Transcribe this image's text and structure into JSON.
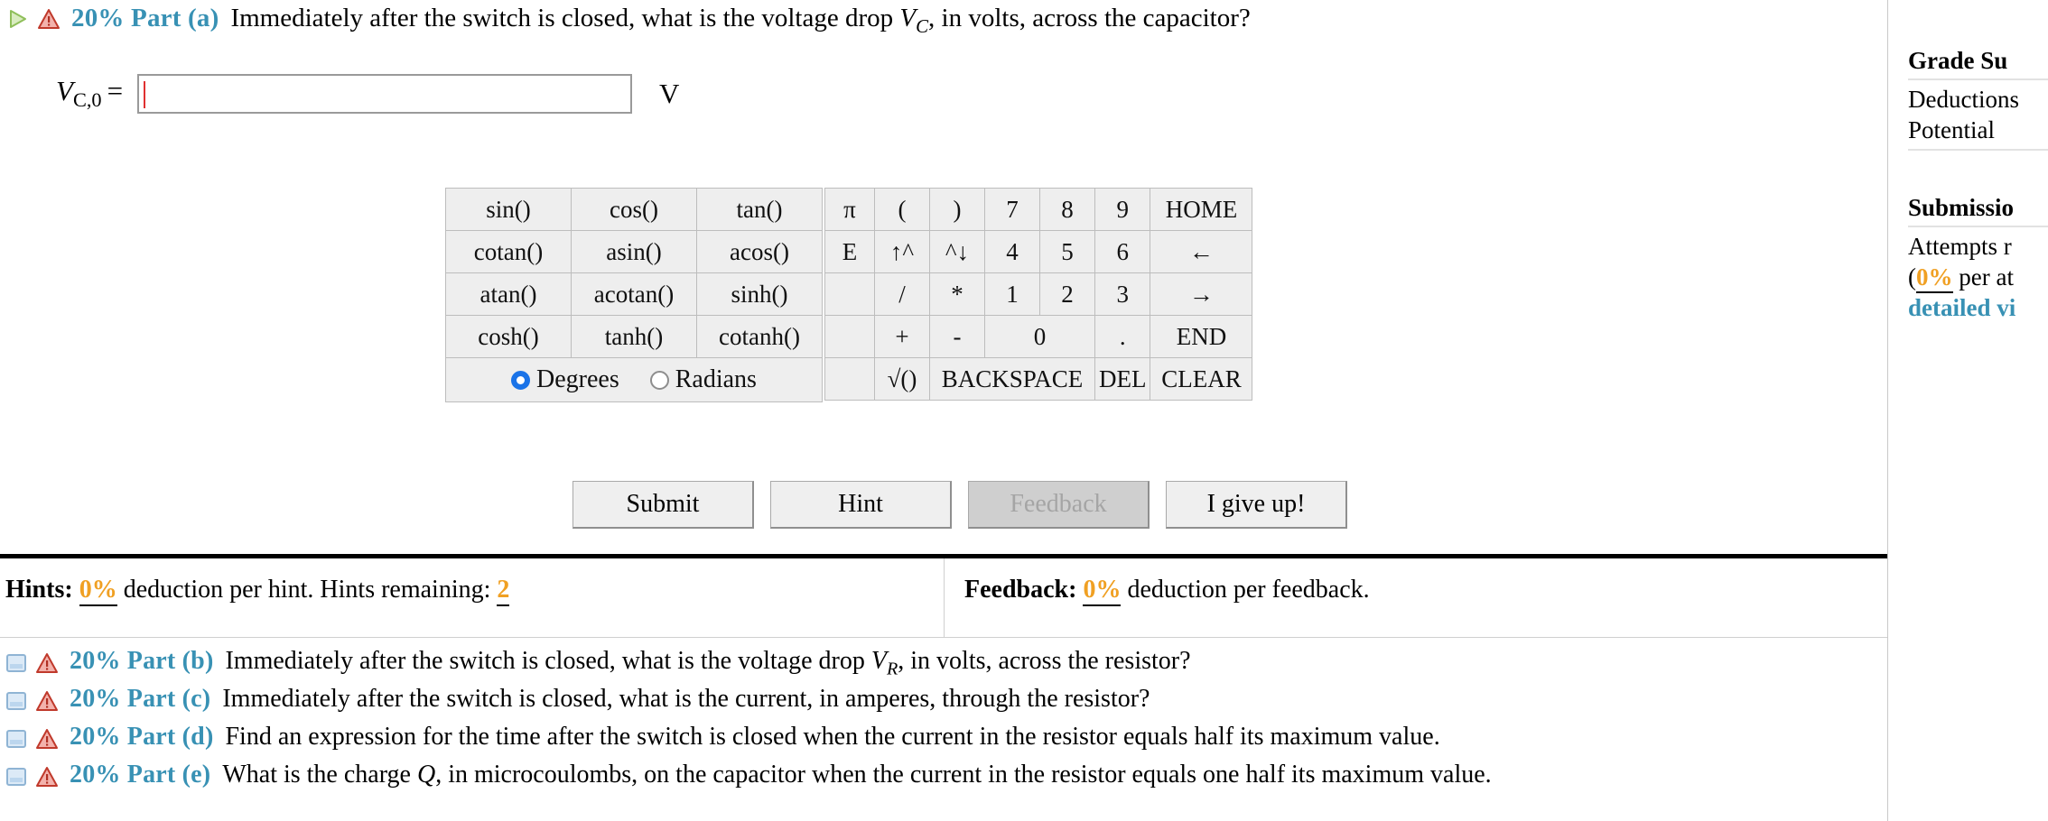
{
  "part_a": {
    "expand_icon": "expand-triangle-icon",
    "warning_icon": "warning-triangle-icon",
    "label": "20% Part (a)",
    "question_pre": "Immediately after the switch is closed, what is the voltage drop ",
    "question_var": "V",
    "question_sub": "C",
    "question_post": ", in volts, across the capacitor?"
  },
  "answer": {
    "label_var": "V",
    "label_sub": "C,0",
    "equals": "=",
    "value": "",
    "placeholder": "",
    "unit": "V"
  },
  "calculator": {
    "functions": [
      [
        "sin()",
        "cos()",
        "tan()"
      ],
      [
        "cotan()",
        "asin()",
        "acos()"
      ],
      [
        "atan()",
        "acotan()",
        "sinh()"
      ],
      [
        "cosh()",
        "tanh()",
        "cotanh()"
      ]
    ],
    "angle_modes": [
      {
        "label": "Degrees",
        "selected": true
      },
      {
        "label": "Radians",
        "selected": false
      }
    ],
    "keypad": [
      [
        {
          "label": "π",
          "disabled": false
        },
        {
          "label": "(",
          "disabled": false
        },
        {
          "label": ")",
          "disabled": true
        },
        {
          "label": "7",
          "disabled": false
        },
        {
          "label": "8",
          "disabled": false
        },
        {
          "label": "9",
          "disabled": false
        },
        {
          "label": "HOME",
          "disabled": true
        }
      ],
      [
        {
          "label": "E",
          "disabled": false
        },
        {
          "label": "↑^",
          "disabled": true
        },
        {
          "label": "^↓",
          "disabled": true
        },
        {
          "label": "4",
          "disabled": false
        },
        {
          "label": "5",
          "disabled": false
        },
        {
          "label": "6",
          "disabled": false
        },
        {
          "label": "←",
          "disabled": true
        }
      ],
      [
        {
          "label": "",
          "disabled": false
        },
        {
          "label": "/",
          "disabled": true
        },
        {
          "label": "*",
          "disabled": true
        },
        {
          "label": "1",
          "disabled": false
        },
        {
          "label": "2",
          "disabled": false
        },
        {
          "label": "3",
          "disabled": false
        },
        {
          "label": "→",
          "disabled": true
        }
      ],
      [
        {
          "label": "",
          "disabled": false
        },
        {
          "label": "+",
          "disabled": false
        },
        {
          "label": "-",
          "disabled": false
        },
        {
          "label": "0",
          "disabled": false
        },
        {
          "label": ".",
          "disabled": false
        },
        {
          "label": "END",
          "disabled": true
        }
      ],
      [
        {
          "label": "",
          "disabled": false
        },
        {
          "label": "√()",
          "disabled": false
        },
        {
          "label": "BACKSPACE",
          "disabled": true
        },
        {
          "label": "DEL",
          "disabled": true
        },
        {
          "label": "CLEAR",
          "disabled": true
        }
      ]
    ]
  },
  "actions": [
    {
      "label": "Submit",
      "disabled": false
    },
    {
      "label": "Hint",
      "disabled": false
    },
    {
      "label": "Feedback",
      "disabled": true
    },
    {
      "label": "I give up!",
      "disabled": false
    }
  ],
  "hints": {
    "title": "Hints:",
    "percent": "0%",
    "text_mid": "deduction per hint. Hints remaining:",
    "remaining": "2"
  },
  "feedback": {
    "title": "Feedback:",
    "percent": "0%",
    "text": "deduction per feedback."
  },
  "other_parts": [
    {
      "icon": "panel-collapsed-icon",
      "warning_icon": "warning-triangle-icon",
      "label": "20% Part (b)",
      "question_pre": "Immediately after the switch is closed, what is the voltage drop ",
      "question_var": "V",
      "question_sub": "R",
      "question_post": ", in volts, across the resistor?"
    },
    {
      "icon": "panel-collapsed-icon",
      "warning_icon": "warning-triangle-icon",
      "label": "20% Part (c)",
      "question_pre": "Immediately after the switch is closed, what is the current, in amperes, through the resistor?",
      "question_var": "",
      "question_sub": "",
      "question_post": ""
    },
    {
      "icon": "panel-collapsed-icon",
      "warning_icon": "warning-triangle-icon",
      "label": "20% Part (d)",
      "question_pre": "Find an expression for the time after the switch is closed when the current in the resistor equals half its maximum value.",
      "question_var": "",
      "question_sub": "",
      "question_post": ""
    },
    {
      "icon": "panel-collapsed-icon",
      "warning_icon": "warning-triangle-icon",
      "label": "20% Part (e)",
      "question_pre": "What is the charge ",
      "question_var": "Q",
      "question_sub": "",
      "question_post": ", in microcoulombs, on the capacitor when the current in the resistor equals one half its maximum value."
    }
  ],
  "sidebar": {
    "grade_summary_title": "Grade Su",
    "deductions_label": "Deductions",
    "potential_label": "Potential",
    "submissions_title": "Submissio",
    "attempts_label": "Attempts r",
    "attempt_prefix": "(",
    "attempt_percent": "0%",
    "attempt_suffix": " per at",
    "detailed_link": "detailed vi"
  },
  "colors": {
    "part_label": "#3891b4",
    "percent_orange": "#f0a023",
    "link": "#3891b4",
    "radio_selected": "#1a73e8",
    "caret": "#e03030"
  }
}
